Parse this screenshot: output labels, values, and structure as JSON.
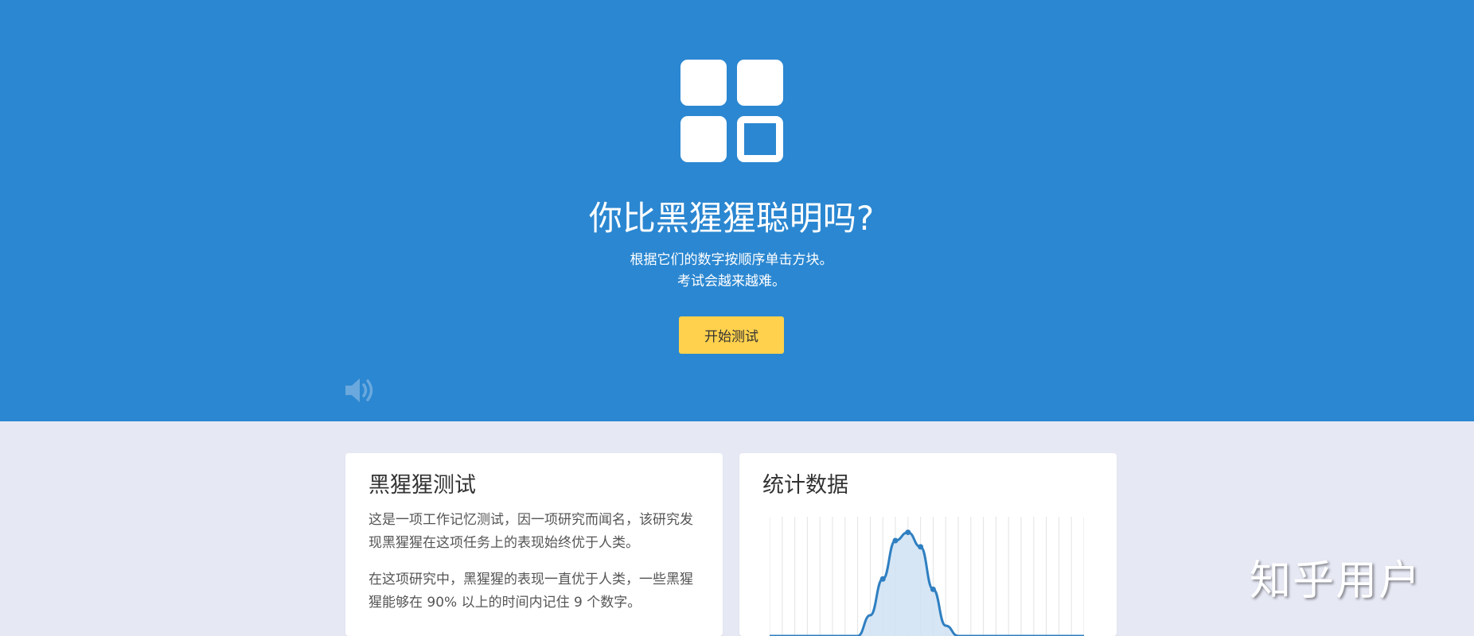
{
  "hero": {
    "logo_icon": "grid-squares-icon",
    "title": "你比黑猩猩聪明吗?",
    "subtitle_lines": [
      "根据它们的数字按顺序单击方块。",
      "考试会越来越难。"
    ],
    "start_button": "开始测试",
    "sound_icon": "speaker-volume-icon",
    "colors": {
      "background": "#2b87d1",
      "button": "#ffd14d"
    }
  },
  "info_card": {
    "title": "黑猩猩测试",
    "paragraphs": [
      "这是一项工作记忆测试，因一项研究而闻名，该研究发现黑猩猩在这项任务上的表现始终优于人类。",
      "在这项研究中，黑猩猩的表现一直优于人类，一些黑猩猩能够在 90% 以上的时间内记住 9 个数字。"
    ]
  },
  "stats_card": {
    "title": "统计数据"
  },
  "chart_data": {
    "type": "area",
    "title": "",
    "xlabel": "",
    "ylabel": "",
    "grid": "vertical lines only",
    "x": [
      0,
      1,
      2,
      3,
      4,
      5,
      6,
      7,
      8,
      9,
      10,
      11,
      12,
      13,
      14,
      15,
      16,
      17,
      18,
      19,
      20,
      21,
      22,
      23,
      24,
      25
    ],
    "y": [
      0,
      0,
      0,
      0,
      0,
      0,
      0,
      0,
      0.2,
      0.55,
      0.92,
      1.0,
      0.86,
      0.45,
      0.1,
      0,
      0,
      0,
      0,
      0,
      0,
      0,
      0,
      0,
      0,
      0
    ],
    "xlim": [
      0,
      25
    ],
    "ylim": [
      0,
      1.15
    ],
    "line_color": "#2f7fc1",
    "fill_color": "#cfe2f3"
  },
  "watermark": "知乎用户"
}
